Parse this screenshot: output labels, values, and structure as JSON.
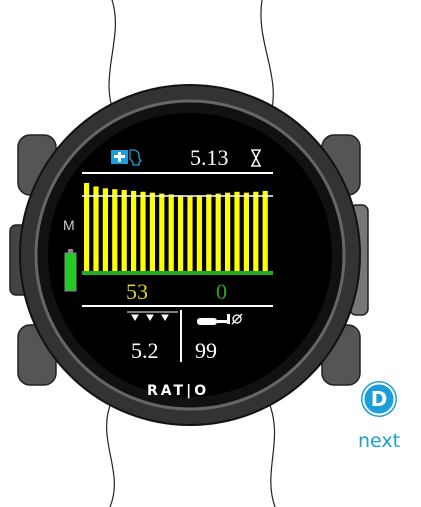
{
  "dive_screen": {
    "time_value": "5.13",
    "marker_label": "M",
    "bottom_left_value": "53",
    "bottom_right_value": "0",
    "footer_left_value": "5.2",
    "footer_right_value": "99",
    "brand": "RAT|O"
  },
  "chart_data": {
    "type": "bar",
    "values": [
      100,
      96,
      94,
      93,
      92,
      91,
      90,
      89,
      88,
      87,
      86,
      85,
      86,
      87,
      88,
      89,
      90,
      89,
      90,
      91
    ]
  },
  "colors": {
    "bars": "#ffff00",
    "baseline": "#22aa22",
    "battery": "#22cc22",
    "accent": "#1a9fd8",
    "yellow_text": "#e0d020",
    "green_text": "#22aa22"
  },
  "controls": {
    "next_button_letter": "D",
    "next_label": "next"
  }
}
